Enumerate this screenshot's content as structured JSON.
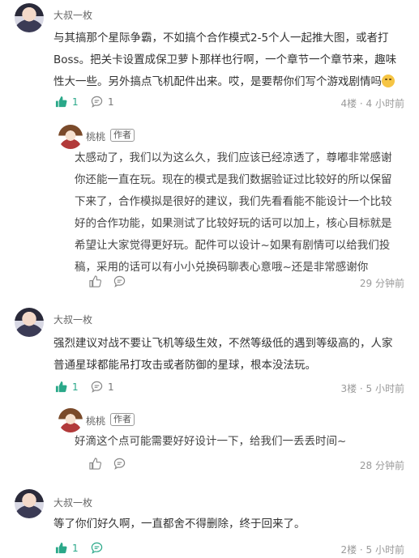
{
  "comments": [
    {
      "author": "大叔一枚",
      "lines": [
        "与其搞那个星际争霸，不如搞个合作模式2-5个人一起推大图，或者打",
        "Boss。把关卡设置成保卫萝卜那样也行啊，一个章节一个章节来，趣味",
        "性大一些。另外搞点飞机配件出来。哎，是要帮你们写个游戏剧情吗"
      ],
      "likes": "1",
      "replies": "1",
      "meta": "4楼 · 4 小时前",
      "reply": {
        "author": "桃桃",
        "badge": "作者",
        "lines": [
          "太感动了，我们以为这么久，我们应该已经凉透了，尊嘟非常感谢",
          "你还能一直在玩。现在的模式是我们数据验证过比较好的所以保留",
          "下来了，合作模拟是很好的建议，我们先看看能不能设计一个比较",
          "好的合作功能，如果测试了比较好玩的话可以加上，核心目标就是",
          "希望让大家觉得更好玩。配件可以设计~如果有剧情可以给我们投",
          "稿，采用的话可以有小小兑换码聊表心意哦~还是非常感谢你"
        ],
        "meta": "29 分钟前"
      }
    },
    {
      "author": "大叔一枚",
      "lines": [
        "强烈建议对战不要让飞机等级生效，不然等级低的遇到等级高的，人家",
        "普通星球都能吊打攻击或者防御的星球，根本没法玩。"
      ],
      "likes": "1",
      "replies": "1",
      "meta": "3楼 · 5 小时前",
      "reply": {
        "author": "桃桃",
        "badge": "作者",
        "lines": [
          "好滴这个点可能需要好好设计一下，给我们一丢丢时间~"
        ],
        "meta": "28 分钟前"
      }
    },
    {
      "author": "大叔一枚",
      "lines": [
        "等了你们好久啊，一直都舍不得删除，终于回来了。"
      ],
      "likes": "1",
      "meta": "2楼 · 5 小时前"
    }
  ],
  "icons": {
    "like": "thumbs-up-icon",
    "comment": "comment-icon",
    "emoji": "smile-emoji-icon"
  },
  "colors": {
    "like_active": "#2aa889",
    "meta": "#9a9a9a"
  }
}
